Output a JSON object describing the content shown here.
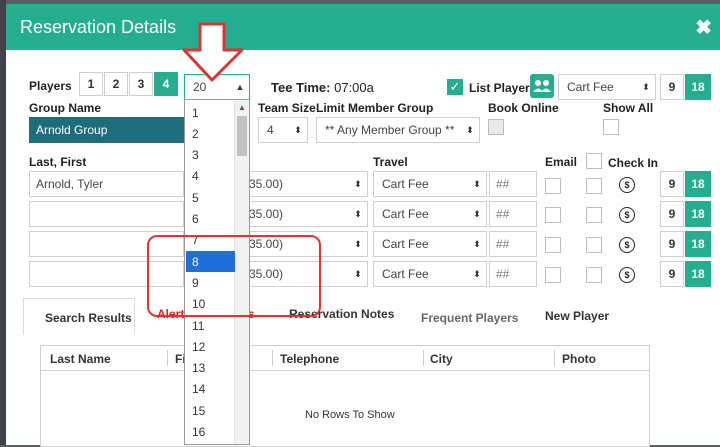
{
  "modal": {
    "title": "Reservation Details"
  },
  "players": {
    "label": "Players",
    "buttons": [
      "1",
      "2",
      "3",
      "4"
    ],
    "active_index": 3,
    "count_select": "20"
  },
  "tee_time": {
    "label": "Tee Time:",
    "value": "07:00a"
  },
  "list_players": {
    "label": "List Players",
    "checked": true
  },
  "fee_select": "Cart Fee",
  "holes": {
    "nine": "9",
    "eighteen": "18"
  },
  "group": {
    "label": "Group Name",
    "value": "Arnold Group"
  },
  "team_size": {
    "label": "Team Size",
    "value": "4"
  },
  "limit_member_group": {
    "label": "Limit Member Group",
    "value": "** Any Member Group **"
  },
  "book_online": {
    "label": "Book Online"
  },
  "show_all": {
    "label": "Show All"
  },
  "player_headers": {
    "name": "Last, First",
    "travel": "Travel",
    "email": "Email",
    "check_in": "Check In"
  },
  "rows": [
    {
      "name": "Arnold, Tyler",
      "rate": "35.00)",
      "travel": "Cart Fee",
      "amount_placeholder": "##"
    },
    {
      "name": "",
      "rate": "35.00)",
      "travel": "Cart Fee",
      "amount_placeholder": "##"
    },
    {
      "name": "",
      "rate": "35.00)",
      "travel": "Cart Fee",
      "amount_placeholder": "##"
    },
    {
      "name": "",
      "rate": "35.00)",
      "travel": "Cart Fee",
      "amount_placeholder": "##"
    }
  ],
  "tabs": {
    "search_results": "Search Results",
    "alerts_partial": "Alert",
    "alerts_tail": "s",
    "reservation_notes": "Reservation Notes",
    "frequent_players": "Frequent Players",
    "new_player": "New Player"
  },
  "grid": {
    "columns": [
      "Last Name",
      "Fi",
      "Telephone",
      "City",
      "Photo"
    ],
    "empty_message": "No Rows To Show"
  },
  "dropdown_options": [
    "1",
    "2",
    "3",
    "4",
    "5",
    "6",
    "7",
    "8",
    "9",
    "10",
    "11",
    "12",
    "13",
    "14",
    "15",
    "16"
  ],
  "dropdown_selected": "8",
  "colors": {
    "accent": "#25ad8f",
    "selected": "#1e6fd9",
    "annotation": "#e03333",
    "alert_tab": "#e02020"
  },
  "icons": {
    "close": "close-icon",
    "dollar": "dollar-circle-icon",
    "group": "group-icon",
    "annotation": "down-arrow-annotation"
  }
}
